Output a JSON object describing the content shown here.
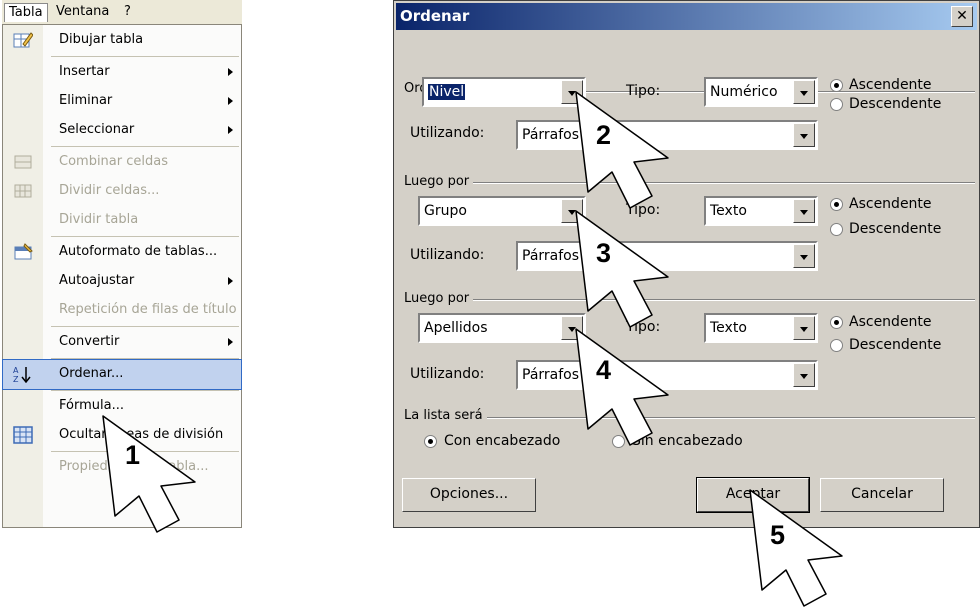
{
  "menubar": {
    "tabla": "Tabla",
    "ventana": "Ventana",
    "help": "?"
  },
  "menu": {
    "items": [
      {
        "label": "Dibujar tabla",
        "disabled": false,
        "submenu": false,
        "icon": "pencil-table-icon"
      },
      {
        "label": "Insertar",
        "disabled": false,
        "submenu": true
      },
      {
        "label": "Eliminar",
        "disabled": false,
        "submenu": true
      },
      {
        "label": "Seleccionar",
        "disabled": false,
        "submenu": true
      },
      {
        "label": "Combinar celdas",
        "disabled": true,
        "submenu": false,
        "icon": "merge-cells-icon"
      },
      {
        "label": "Dividir celdas...",
        "disabled": true,
        "submenu": false,
        "icon": "split-cells-icon"
      },
      {
        "label": "Dividir tabla",
        "disabled": true,
        "submenu": false
      },
      {
        "label": "Autoformato de tablas...",
        "disabled": false,
        "submenu": false,
        "icon": "autoformat-icon"
      },
      {
        "label": "Autoajustar",
        "disabled": false,
        "submenu": true
      },
      {
        "label": "Repetición de filas de título",
        "disabled": true,
        "submenu": false
      },
      {
        "label": "Convertir",
        "disabled": false,
        "submenu": true
      },
      {
        "label": "Ordenar...",
        "disabled": false,
        "submenu": false,
        "icon": "sort-az-icon",
        "highlighted": true
      },
      {
        "label": "Fórmula...",
        "disabled": false,
        "submenu": false
      },
      {
        "label": "Ocultar líneas de división",
        "disabled": false,
        "submenu": false,
        "icon": "grid-icon"
      },
      {
        "label": "Propiedades de tabla...",
        "disabled": true,
        "submenu": false
      }
    ]
  },
  "dialog": {
    "title": "Ordenar",
    "close": "✕",
    "sort1": {
      "group": "Ordenar por",
      "field": "Nivel",
      "tipo_label": "Tipo:",
      "tipo": "Numérico",
      "using_label": "Utilizando:",
      "using": "Párrafos",
      "asc": "Ascendente",
      "desc": "Descendente",
      "order": "asc"
    },
    "sort2": {
      "group": "Luego por",
      "field": "Grupo",
      "tipo_label": "Tipo:",
      "tipo": "Texto",
      "using_label": "Utilizando:",
      "using": "Párrafos",
      "asc": "Ascendente",
      "desc": "Descendente",
      "order": "asc"
    },
    "sort3": {
      "group": "Luego por",
      "field": "Apellidos",
      "tipo_label": "Tipo:",
      "tipo": "Texto",
      "using_label": "Utilizando:",
      "using": "Párrafos",
      "asc": "Ascendente",
      "desc": "Descendente",
      "order": "asc"
    },
    "list": {
      "group": "La lista será",
      "header": "Con encabezado",
      "noheader": "Sin encabezado",
      "selected": "header"
    },
    "buttons": {
      "options": "Opciones...",
      "ok": "Aceptar",
      "cancel": "Cancelar"
    }
  },
  "pointers": [
    "1",
    "2",
    "3",
    "4",
    "5"
  ]
}
